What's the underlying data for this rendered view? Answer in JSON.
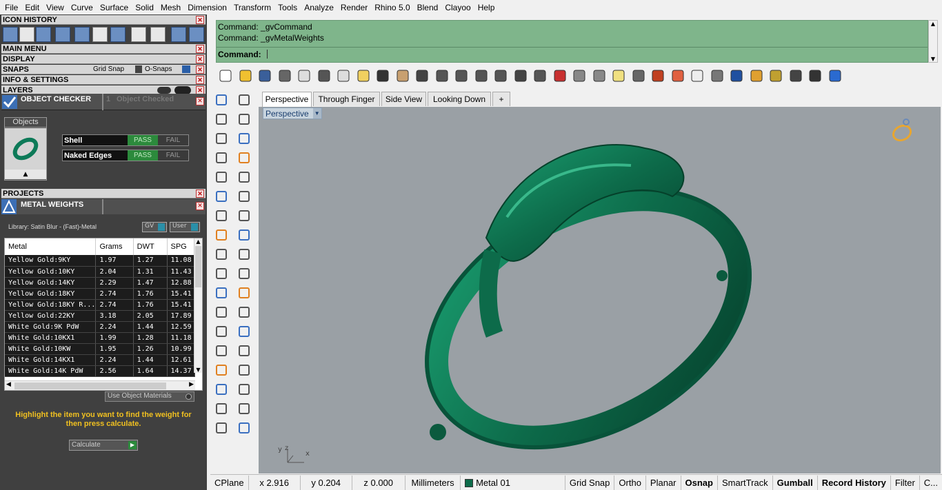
{
  "menubar": [
    "File",
    "Edit",
    "View",
    "Curve",
    "Surface",
    "Solid",
    "Mesh",
    "Dimension",
    "Transform",
    "Tools",
    "Analyze",
    "Render",
    "Rhino 5.0",
    "Blend",
    "Clayoo",
    "Help"
  ],
  "panels": {
    "icon_history": "ICON HISTORY",
    "main_menu": "MAIN MENU",
    "display": "DISPLAY",
    "snaps": "SNAPS",
    "grid_snap": "Grid Snap",
    "o_snaps": "O-Snaps",
    "info_settings": "INFO & SETTINGS",
    "layers": "LAYERS",
    "object_checker": "OBJECT CHECKER",
    "object_checked_count": "1",
    "object_checked": "Object Checked",
    "objects_tab": "Objects",
    "checks": [
      {
        "name": "Shell",
        "pass": "PASS",
        "fail": "FAIL"
      },
      {
        "name": "Naked Edges",
        "pass": "PASS",
        "fail": "FAIL"
      }
    ],
    "projects": "PROJECTS",
    "metal_weights": "METAL WEIGHTS",
    "library": "Library: Satin Blur - (Fast)-Metal",
    "gv": "GV",
    "user": "User",
    "use_object_materials": "Use Object Materials",
    "hint": "Highlight the item you want to find the weight for then press calculate.",
    "calculate": "Calculate"
  },
  "metal_table": {
    "headers": [
      "Metal",
      "Grams",
      "DWT",
      "SPG"
    ],
    "rows": [
      [
        "Yellow Gold:9KY",
        "1.97",
        "1.27",
        "11.08"
      ],
      [
        "Yellow Gold:10KY",
        "2.04",
        "1.31",
        "11.43"
      ],
      [
        "Yellow Gold:14KY",
        "2.29",
        "1.47",
        "12.88"
      ],
      [
        "Yellow Gold:18KY",
        "2.74",
        "1.76",
        "15.41"
      ],
      [
        "Yellow Gold:18KY R...",
        "2.74",
        "1.76",
        "15.41"
      ],
      [
        "Yellow Gold:22KY",
        "3.18",
        "2.05",
        "17.89"
      ],
      [
        "White Gold:9K PdW",
        "2.24",
        "1.44",
        "12.59"
      ],
      [
        "White Gold:10KX1",
        "1.99",
        "1.28",
        "11.18"
      ],
      [
        "White Gold:10KW",
        "1.95",
        "1.26",
        "10.99"
      ],
      [
        "White Gold:14KX1",
        "2.24",
        "1.44",
        "12.61"
      ],
      [
        "White Gold:14K PdW",
        "2.56",
        "1.64",
        "14.37"
      ]
    ]
  },
  "command": {
    "lines": [
      "Command: _gvCommand",
      "Command: _gvMetalWeights"
    ],
    "prompt": "Command:"
  },
  "viewport": {
    "tabs": [
      "Perspective",
      "Through Finger",
      "Side View",
      "Looking Down"
    ],
    "add_tab": "+",
    "active_label": "Perspective",
    "axis_x": "x",
    "axis_y": "y",
    "axis_z": "z"
  },
  "status": {
    "cplane": "CPlane",
    "x": "x 2.916",
    "y": "y 0.204",
    "z": "z 0.000",
    "units": "Millimeters",
    "layer": "Metal 01",
    "grid_snap": "Grid Snap",
    "ortho": "Ortho",
    "planar": "Planar",
    "osnap": "Osnap",
    "smarttrack": "SmartTrack",
    "gumball": "Gumball",
    "record_history": "Record History",
    "filter": "Filter",
    "c": "C..."
  },
  "colors": {
    "ring": "#0d6b4a",
    "command_bg": "#7fb58b",
    "viewport_bg": "#9aa0a5"
  }
}
